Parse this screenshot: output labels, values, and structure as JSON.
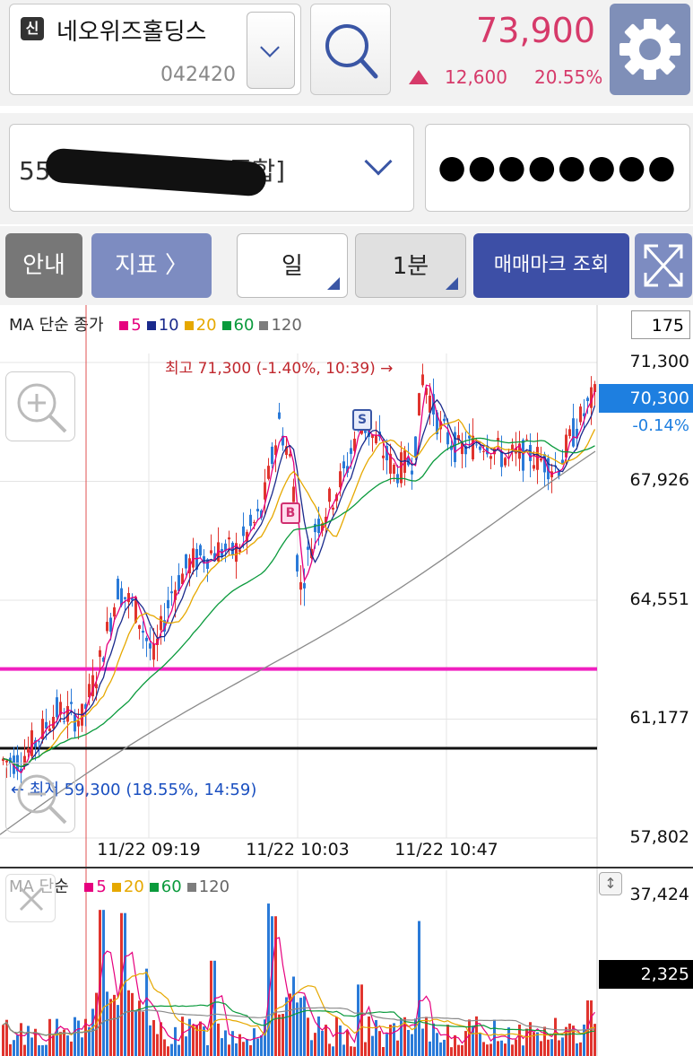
{
  "header": {
    "badge": "신",
    "stock_name": "네오위즈홀딩스",
    "stock_code": "042420",
    "price": "73,900",
    "change": "12,600",
    "change_pct": "20.55%"
  },
  "account": {
    "account_visible_prefix": "55",
    "account_visible_suffix": "[종합]",
    "password_mask": "●●●●●●●●"
  },
  "toolbar": {
    "info_label": "안내",
    "indicator_label": "지표 〉",
    "period_day": "일",
    "period_min": "1분",
    "trade_mark_label": "매매마크 조회"
  },
  "price_chart": {
    "legend_prefix": "MA 단순 종가",
    "ma_legend": [
      {
        "label": "5",
        "color": "#e6007e"
      },
      {
        "label": "10",
        "color": "#1a2a8c"
      },
      {
        "label": "20",
        "color": "#e6a800"
      },
      {
        "label": "60",
        "color": "#0a9a3c"
      },
      {
        "label": "120",
        "color": "#7d7d7d"
      }
    ],
    "count_box": "175",
    "high_annotation": "최고 71,300 (-1.40%, 10:39) →",
    "low_annotation": "← 최저 59,300 (18.55%, 14:59)",
    "current_price": "70,300",
    "current_pct": "-0.14%",
    "buy_mark": "B",
    "sell_mark": "S"
  },
  "volume_chart": {
    "legend_prefix": "MA 단순",
    "ma_legend": [
      {
        "label": "5",
        "color": "#e6007e"
      },
      {
        "label": "20",
        "color": "#e6a800"
      },
      {
        "label": "60",
        "color": "#0a9a3c"
      },
      {
        "label": "120",
        "color": "#7d7d7d"
      }
    ],
    "current_volume": "2,325"
  },
  "chart_data": {
    "type": "candlestick",
    "y_ticks": [
      "71,300",
      "67,926",
      "64,551",
      "61,177",
      "57,802"
    ],
    "y_tick_values": [
      71300,
      67926,
      64551,
      61177,
      57802
    ],
    "x_ticks": [
      "11/22 09:19",
      "11/22 10:03",
      "11/22 10:47"
    ],
    "volume_ticks": [
      "37,424"
    ],
    "volume_tick_values": [
      37424
    ],
    "ylim": [
      57802,
      71300
    ],
    "volume_max": 37424,
    "magenta_line_value": 62600,
    "black_line_value": 60350
  }
}
